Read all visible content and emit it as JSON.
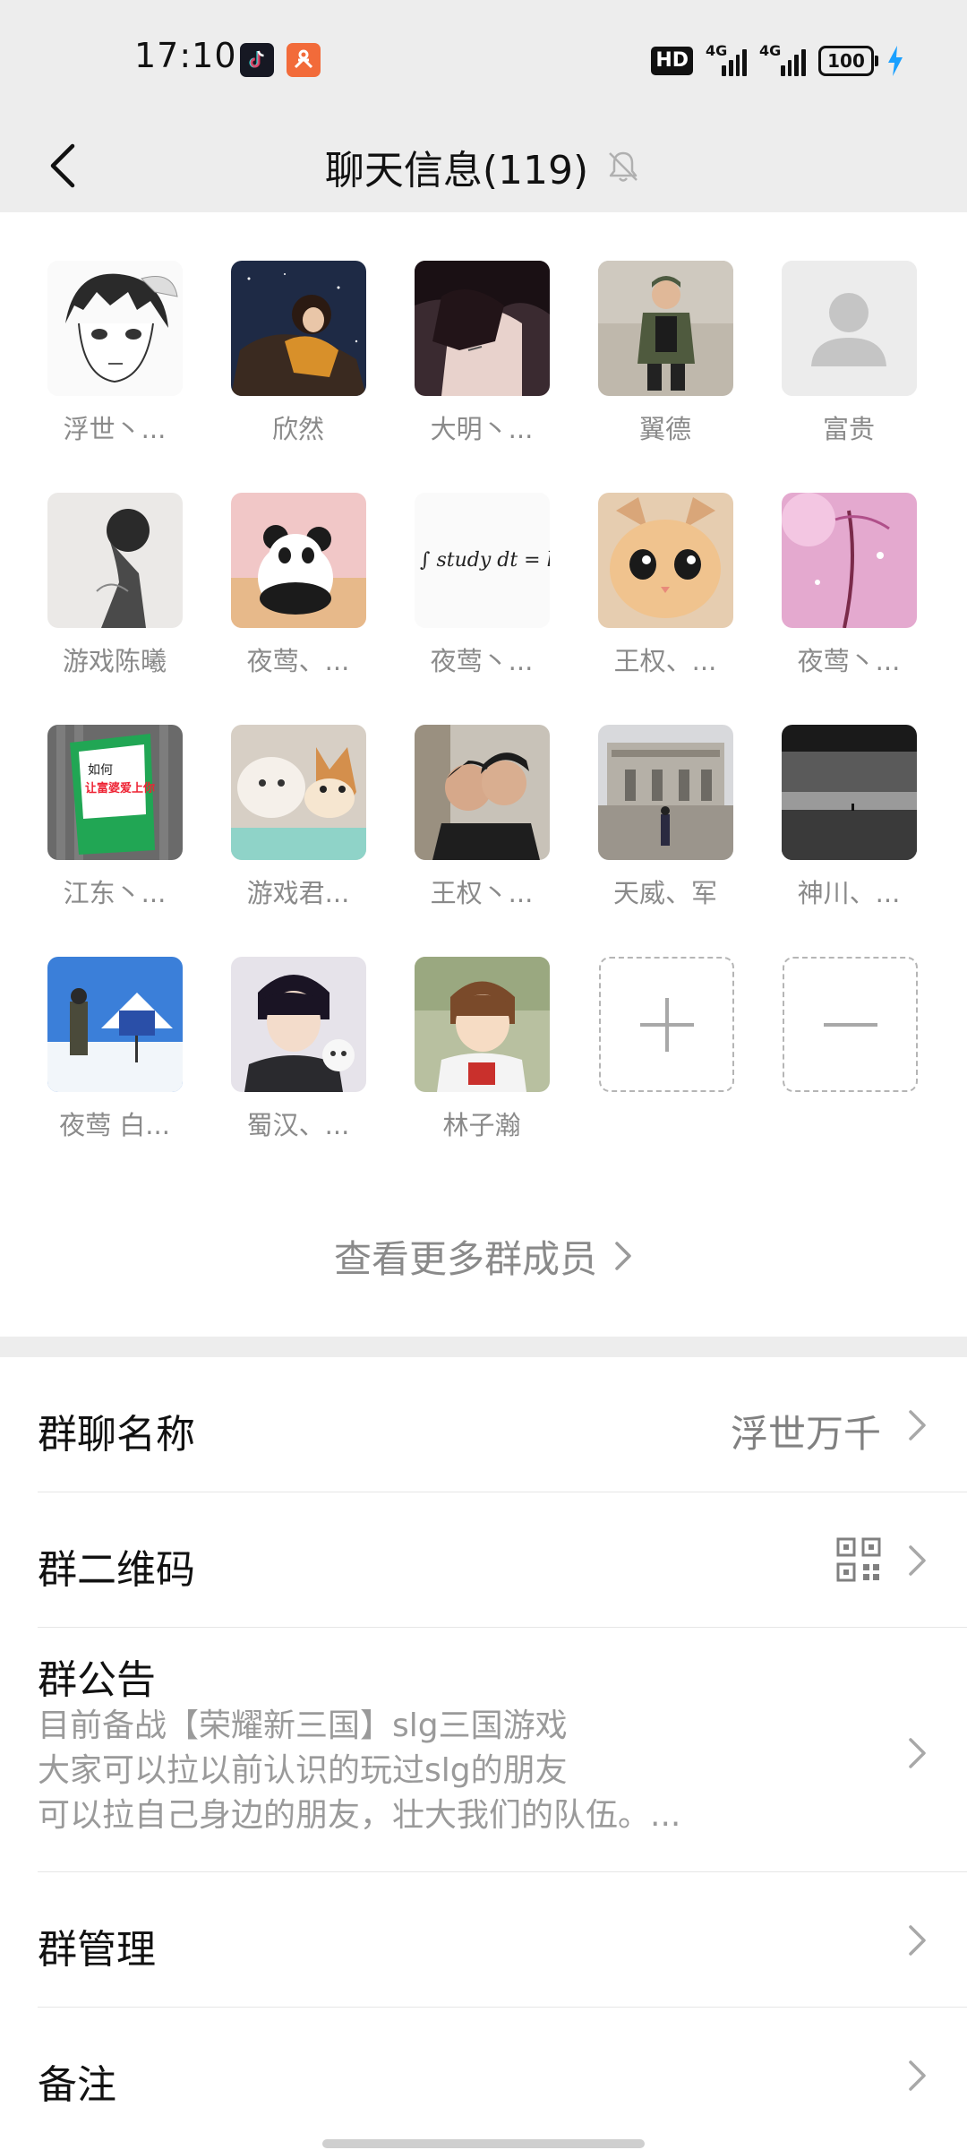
{
  "status_bar": {
    "time": "17:10",
    "hd_label": "HD",
    "sim1_label": "4G",
    "sim2_label": "4G",
    "battery": "100",
    "icons": [
      "tiktok-icon",
      "app-orange-icon",
      "hd-icon",
      "signal-icon",
      "battery-icon",
      "charging-icon"
    ]
  },
  "nav": {
    "title": "聊天信息(119)",
    "icons": [
      "back-icon",
      "mute-bell-icon"
    ]
  },
  "members": [
    {
      "name": "浮世丶..."
    },
    {
      "name": "欣然"
    },
    {
      "name": "大明丶..."
    },
    {
      "name": "翼德"
    },
    {
      "name": "富贵"
    },
    {
      "name": "游戏陈曦"
    },
    {
      "name": "夜莺、..."
    },
    {
      "name": "夜莺丶..."
    },
    {
      "name": "王权、..."
    },
    {
      "name": "夜莺丶..."
    },
    {
      "name": "江东丶..."
    },
    {
      "name": "游戏君..."
    },
    {
      "name": "王权丶..."
    },
    {
      "name": "天威、军"
    },
    {
      "name": "神川、..."
    },
    {
      "name": "夜莺 白..."
    },
    {
      "name": "蜀汉、..."
    },
    {
      "name": "林子瀚"
    }
  ],
  "avatar_texts": {
    "math_formula": "∫ study dt = life",
    "book_line1": "如何",
    "book_line2": "让富婆爱上你"
  },
  "member_actions": {
    "add_icon": "plus-icon",
    "remove_icon": "minus-icon"
  },
  "more_members": "查看更多群成员",
  "settings": {
    "group_name_label": "群聊名称",
    "group_name_value": "浮世万千",
    "qr_label": "群二维码",
    "notice_label": "群公告",
    "notice_line1": "目前备战【荣耀新三国】slg三国游戏",
    "notice_line2": "大家可以拉以前认识的玩过slg的朋友",
    "notice_line3": "可以拉自己身边的朋友，壮大我们的队伍。...",
    "manage_label": "群管理",
    "remark_label": "备注"
  },
  "colors": {
    "background": "#ededed",
    "panel": "#ffffff",
    "secondary_text": "#8a8a8a",
    "charging": "#1aa0ff"
  }
}
